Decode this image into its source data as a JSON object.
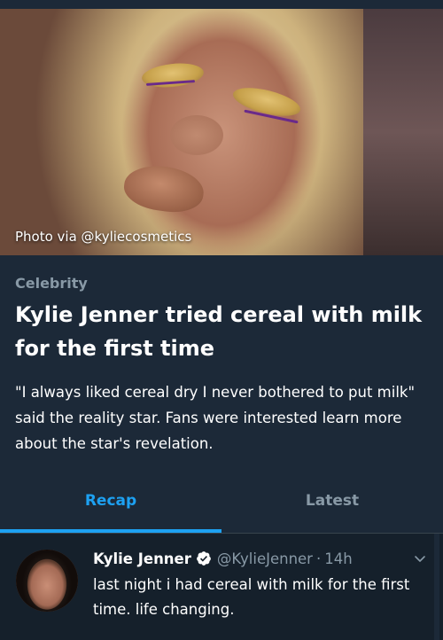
{
  "hero": {
    "caption": "Photo via @kyliecosmetics"
  },
  "article": {
    "category": "Celebrity",
    "headline": "Kylie Jenner tried cereal with milk for the first time",
    "summary": "\"I always liked cereal dry I never bothered to put milk\" said the reality star. Fans were interested learn more about the star's revelation."
  },
  "tabs": [
    {
      "label": "Recap",
      "active": true
    },
    {
      "label": "Latest",
      "active": false
    }
  ],
  "tweet": {
    "name": "Kylie Jenner",
    "handle": "@KylieJenner",
    "separator": "·",
    "time": "14h",
    "text": "last night i had cereal with milk for the first time. life changing.",
    "verified_icon": "verified-badge-icon",
    "menu_icon": "chevron-down-icon"
  },
  "colors": {
    "background": "#15202b",
    "card": "#1c2938",
    "accent": "#1da1f2",
    "muted": "#8899a6"
  }
}
